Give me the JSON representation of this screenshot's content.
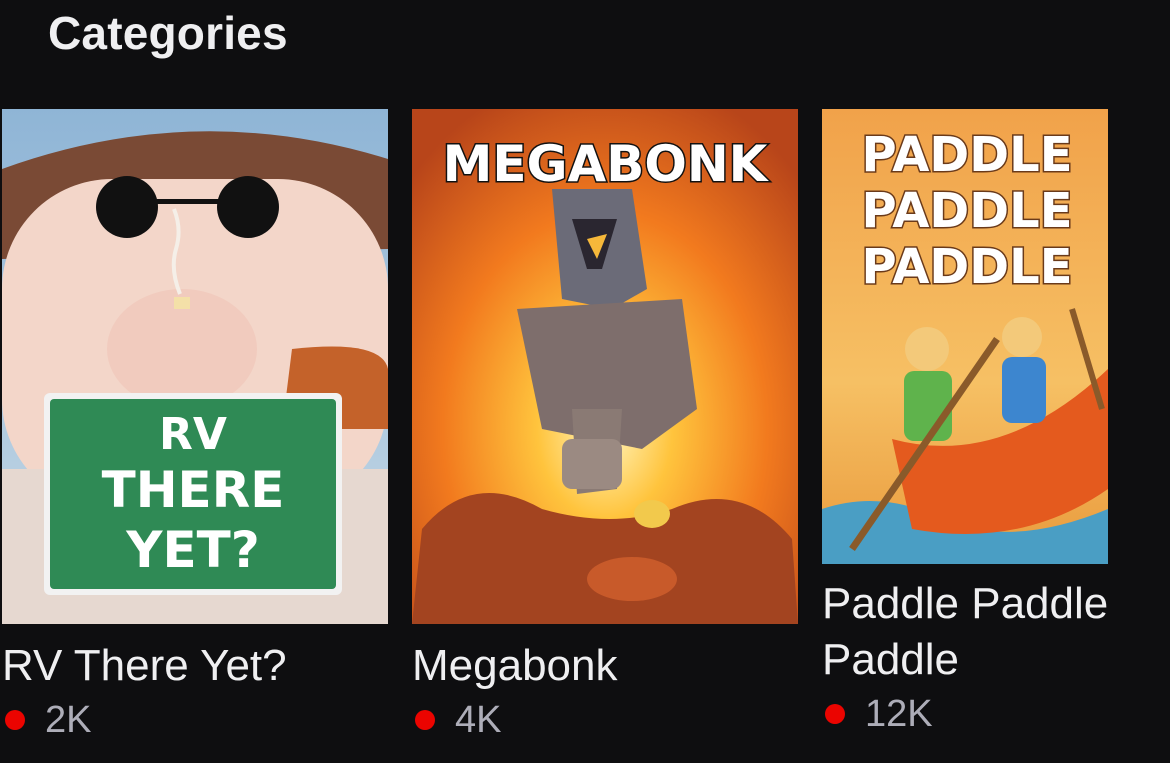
{
  "section": {
    "title": "Categories"
  },
  "categories": [
    {
      "title": "RV There Yet?",
      "viewers": "2K",
      "art_text": [
        "RV",
        "THERE",
        "YET?"
      ]
    },
    {
      "title": "Megabonk",
      "viewers": "4K",
      "art_text": [
        "MEGABONK"
      ]
    },
    {
      "title": "Paddle Paddle Paddle",
      "viewers": "12K",
      "art_text": [
        "PADDLE",
        "PADDLE",
        "PADDLE"
      ]
    }
  ],
  "colors": {
    "background": "#0e0e10",
    "live": "#eb0400",
    "text": "#efeff1",
    "muted": "#adadb8"
  }
}
